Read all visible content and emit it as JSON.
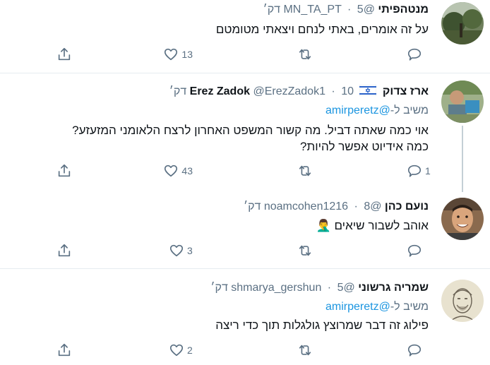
{
  "tweets": [
    {
      "name": "מנטהפיתי",
      "handle": "@MN_TA_PT",
      "time": "5 דק׳",
      "lines": [
        "על זה אומרים, באתי לנחם ויצאתי מטומטם"
      ],
      "likes": "13",
      "replies": "",
      "avatar_icon": "nature-photo-avatar"
    },
    {
      "name": "ארז צדוק",
      "name_suffix": "Erez Zadok",
      "flag_icon": "israel-flag-icon",
      "handle": "@ErezZadok1",
      "time": "10 דק׳",
      "reply_prefix": "משיב ל-",
      "reply_mention": "@amirperetz",
      "lines": [
        "אוי כמה שאתה דביל. מה קשור המשפט האחרון לרצח הלאומני המזעזע?",
        "כמה אידיוט אפשר להיות?"
      ],
      "likes": "43",
      "replies": "1",
      "avatar_icon": "outdoor-photo-avatar"
    },
    {
      "name": "נועם כהן",
      "handle": "@noamcohen1216",
      "time": "8 דק׳",
      "lines": [
        "אוהב לשבור שיאים 🤦‍♂️"
      ],
      "likes": "3",
      "replies": "",
      "avatar_icon": "smiling-man-avatar"
    },
    {
      "name": "שמריה גרשוני",
      "handle": "@shmarya_gershun",
      "time": "5 דק׳",
      "reply_prefix": "משיב ל-",
      "reply_mention": "@amirperetz",
      "lines": [
        "פילוג זה דבר שמרוצץ גולגלות תוך כדי ריצה"
      ],
      "likes": "2",
      "replies": "",
      "avatar_icon": "sketch-portrait-avatar"
    }
  ],
  "colors": {
    "accent": "#1b95e0",
    "muted": "#5b7083",
    "border": "#e6ecf0"
  }
}
